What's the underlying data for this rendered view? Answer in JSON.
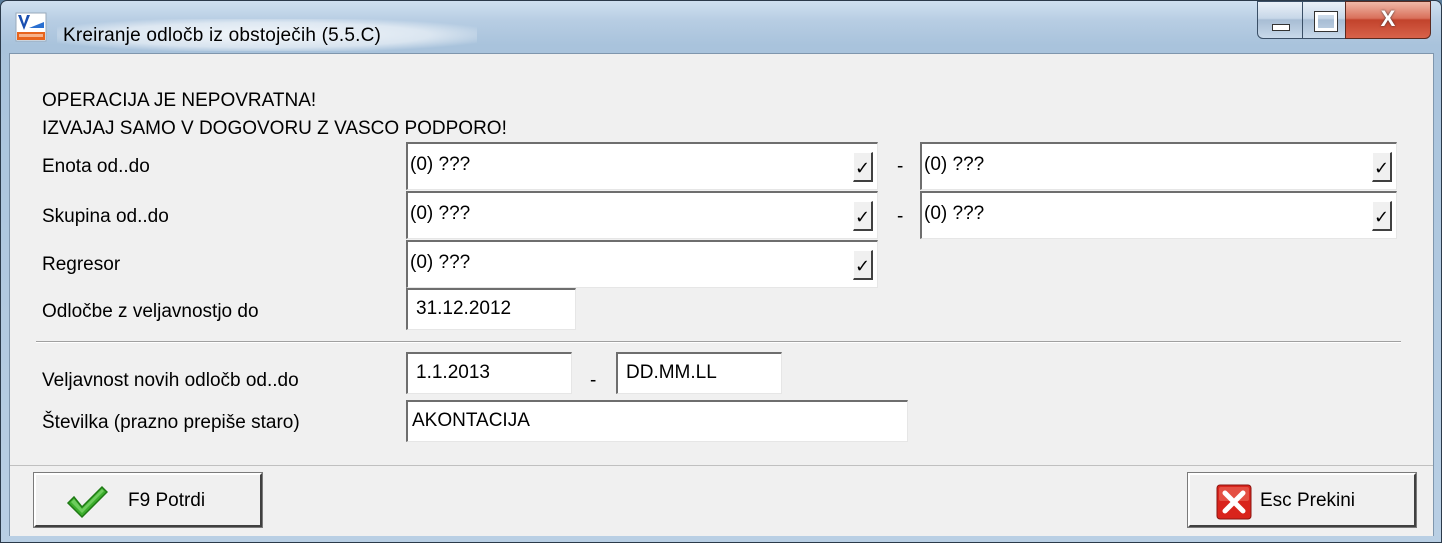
{
  "window": {
    "title": "Kreiranje odločb iz obstoječih  (5.5.C)",
    "controls": {
      "close_glyph": "X"
    }
  },
  "warning": {
    "line1": "OPERACIJA JE NEPOVRATNA!",
    "line2": "IZVAJAJ SAMO V DOGOVORU Z VASCO PODPORO!"
  },
  "form": {
    "enota": {
      "label": "Enota od..do",
      "from": "(0) ???",
      "to": "(0) ???",
      "dash": "-"
    },
    "skupina": {
      "label": "Skupina od..do",
      "from": "(0) ???",
      "to": "(0) ???",
      "dash": "-"
    },
    "regresor": {
      "label": "Regresor",
      "value": "(0) ???"
    },
    "odlocbe_do": {
      "label": "Odločbe z veljavnostjo do",
      "value": "31.12.2012"
    },
    "veljavnost": {
      "label": "Veljavnost novih odločb od..do",
      "from": "1.1.2013",
      "to": "DD.MM.LL",
      "dash": "-"
    },
    "stevilka": {
      "label": "Številka (prazno prepiše staro)",
      "value": "AKONTACIJA"
    },
    "combo_glyph": "✓"
  },
  "buttons": {
    "confirm": {
      "label": "F9 Potrdi",
      "icon": "check-icon",
      "icon_color": "#3cae2c"
    },
    "cancel": {
      "label": "Esc Prekini",
      "icon": "red-x-icon",
      "icon_color": "#d9241c"
    }
  }
}
